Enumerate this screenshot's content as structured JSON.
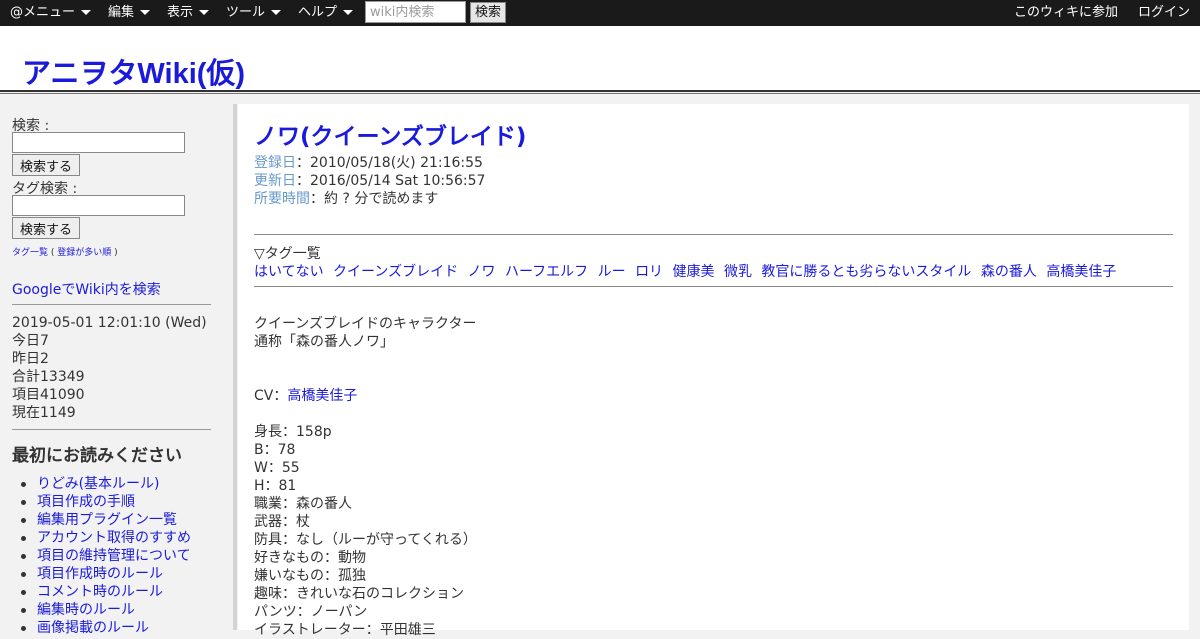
{
  "topbar": {
    "menus": [
      {
        "label": "@メニュー"
      },
      {
        "label": "編集"
      },
      {
        "label": "表示"
      },
      {
        "label": "ツール"
      },
      {
        "label": "ヘルプ"
      }
    ],
    "search_placeholder": "wiki内検索",
    "search_button": "検索",
    "join_link": "このウィキに参加",
    "login_link": "ログイン"
  },
  "header": {
    "site_title": "アニヲタWiki(仮)"
  },
  "sidebar": {
    "search_label": "検索 :",
    "search_button": "検索する",
    "tag_search_label": "タグ検索 :",
    "tag_search_button": "検索する",
    "tag_list_link": "タグ一覧",
    "tag_paren_open": " ( ",
    "tag_popular_link": "登録が多い順",
    "tag_paren_close": " )",
    "google_link": "GoogleでWiki内を検索",
    "stats": {
      "datetime": "2019-05-01 12:01:10 (Wed)",
      "today": "今日7",
      "yesterday": "昨日2",
      "total": "合計13349",
      "items": "項目41090",
      "current": "現在1149"
    },
    "read_first_heading": "最初にお読みください",
    "read_first_items": [
      "りどみ(基本ルール)",
      "項目作成の手順",
      "編集用プラグイン一覧",
      "アカウント取得のすすめ",
      "項目の維持管理について",
      "項目作成時のルール",
      "コメント時のルール",
      "編集時のルール",
      "画像掲載のルール"
    ]
  },
  "main": {
    "title": "ノワ(クイーンズブレイド)",
    "meta": {
      "registered_label": "登録日",
      "registered_value": "：2010/05/18(火) 21:16:55",
      "updated_label": "更新日",
      "updated_value": "：2016/05/14 Sat 10:56:57",
      "time_label": "所要時間",
      "time_value": "：約 ? 分で読めます"
    },
    "tags_heading": "▽タグ一覧",
    "tags": [
      "はいてない",
      "クイーンズブレイド",
      "ノワ",
      "ハーフエルフ",
      "ルー",
      "ロリ",
      "健康美",
      "微乳",
      "教官に勝るとも劣らないスタイル",
      "森の番人",
      "高橋美佳子"
    ],
    "intro1": "クイーンズブレイドのキャラクター",
    "intro2": "通称「森の番人ノワ」",
    "cv_prefix": "CV：",
    "cv_link": "高橋美佳子",
    "profile": [
      "身長：158p",
      "B：78",
      "W：55",
      "H：81",
      "職業：森の番人",
      "武器：杖",
      "防具：なし（ルーが守ってくれる）",
      "好きなもの：動物",
      "嫌いなもの：孤独",
      "趣味：きれいな石のコレクション",
      "パンツ：ノーパン",
      "イラストレーター：平田雄三"
    ]
  }
}
